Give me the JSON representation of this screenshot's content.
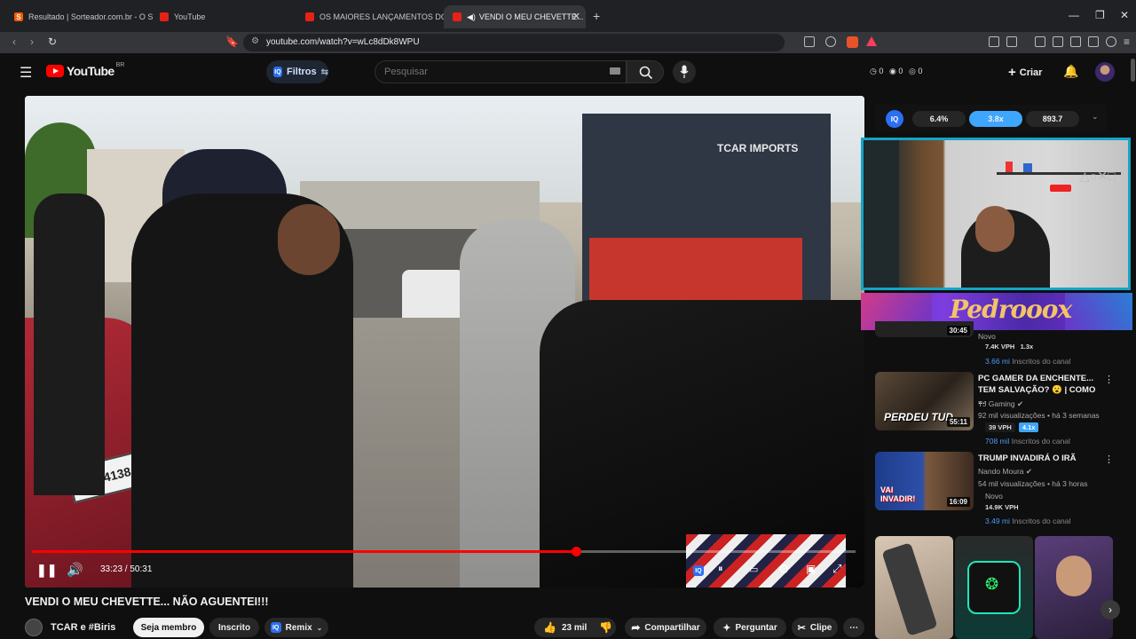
{
  "browser": {
    "tabs": [
      {
        "label": "Resultado | Sorteador.com.br - O Site",
        "favicon": "sorteador-favicon"
      },
      {
        "label": "YouTube",
        "favicon": "youtube-favicon"
      },
      {
        "label": "OS MAIORES LANÇAMENTOS DO CI",
        "favicon": "youtube-favicon"
      },
      {
        "label": "VENDI O MEU CHEVETTE... N",
        "favicon": "youtube-favicon",
        "active": true
      }
    ],
    "new_tab": "+",
    "url": "youtube.com/watch?v=wLc8dDk8WPU"
  },
  "header": {
    "logo_text": "YouTube",
    "logo_region": "BR",
    "filters_label": "Filtros",
    "search_placeholder": "Pesquisar",
    "stats": [
      "0",
      "0",
      "0"
    ],
    "create_label": "Criar",
    "iq_badge": "IQ"
  },
  "player": {
    "time_current": "33:23",
    "time_total": "50:31",
    "time_display": "33:23 / 50:31",
    "progress": 0.661,
    "iq_badge": "IQ"
  },
  "video": {
    "title": "VENDI O MEU CHEVETTE... NÃO AGUENTEI!!!",
    "channel": "TCAR e #Biris",
    "join_label": "Seja membro",
    "subscribed_label": "Inscrito",
    "remix_label": "Remix",
    "likes": "23 mil",
    "share_label": "Compartilhar",
    "ask_label": "Perguntar",
    "clip_label": "Clipe"
  },
  "iq_panel": {
    "badge": "IQ",
    "values": [
      "6.4%",
      "3.8x",
      "893.7"
    ]
  },
  "overlay": {
    "streamer_banner": "Pedrooox",
    "video_sign": "TCAR IMPORTS"
  },
  "recommendations": [
    {
      "partial": true,
      "duration": "30:45",
      "badges": [
        {
          "text": "Novo",
          "style": "plain"
        }
      ],
      "stats": [
        "7.4K VPH",
        "1.3x"
      ],
      "subs_num": "3.66 mi",
      "subs_label": "Inscritos do canal"
    },
    {
      "title": "PC GAMER DA ENCHENTE... TEM SALVAÇÃO? 😮 | COMO ...",
      "channel": "TJ Gaming",
      "meta": "92 mil visualizações • há 3 semanas",
      "thumb_text": "PERDEU TUD",
      "duration": "55:11",
      "stats": [
        "39 VPH",
        "4.1x"
      ],
      "subs_num": "708 mil",
      "subs_label": "Inscritos do canal"
    },
    {
      "title": "TRUMP INVADIRÁ O IRÃ",
      "channel": "Nando Moura",
      "meta": "54 mil visualizações • há 3 horas",
      "thumb_text": "VAI INVADIR!",
      "duration": "16:09",
      "badge_new": "Novo",
      "stats": [
        "14.9K VPH"
      ],
      "subs_num": "3.49 mi",
      "subs_label": "Inscritos do canal"
    }
  ],
  "colors": {
    "yt_red": "#ff0000",
    "accent_blue": "#3ea6ff",
    "webcam_border": "#15a4c6",
    "banner_purple": "#6a35c8"
  }
}
